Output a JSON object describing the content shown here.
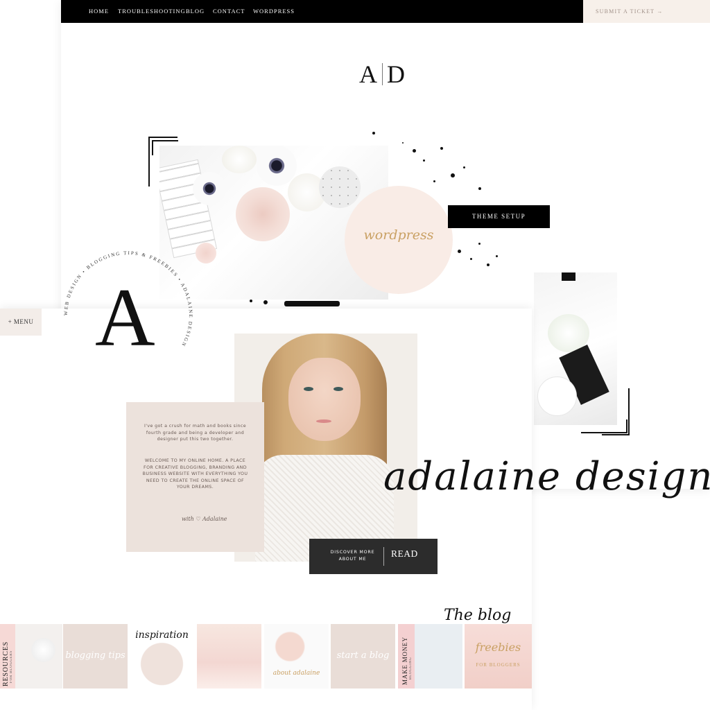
{
  "back_site": {
    "nav": {
      "items": [
        "HOME",
        "TROUBLESHOOTING",
        "BLOG",
        "CONTACT",
        "WORDPRESS"
      ],
      "ticket_label": "SUBMIT A TICKET →"
    },
    "logo": {
      "left": "A",
      "right": "D"
    },
    "hero": {
      "circle_label": "wordpress",
      "cta_label": "THEME SETUP"
    }
  },
  "front_site": {
    "menu_label": "+ MENU",
    "logo_letter": "A",
    "logo_ring_text": "WEB DESIGN • BLOGGING TIPS & FREEBIES • ADALAINE DESIGN",
    "intro": {
      "paragraph_1": "I've got a crush for math and books since fourth grade and being a developer and designer put this two together.",
      "paragraph_2": "WELCOME TO MY ONLINE HOME. A PLACE FOR CREATIVE BLOGGING, BRANDING AND BUSINESS WEBSITE WITH EVERYTHING YOU NEED TO CREATE THE ONLINE SPACE OF YOUR DREAMS.",
      "signoff": "with ♡ Adalaine"
    },
    "cta": {
      "small_label": "DISCOVER MORE ABOUT ME",
      "big_label": "READ"
    },
    "brand_script": "adalaine design",
    "blog_heading": "The blog",
    "thumbnails": [
      {
        "label": "RESOURCES",
        "sub": "FOR BLOGGERS"
      },
      {
        "label": "blogging tips",
        "sub": ""
      },
      {
        "label": "inspiration",
        "sub": ""
      },
      {
        "label": "",
        "sub": ""
      },
      {
        "label": "about adalaine",
        "sub": ""
      },
      {
        "label": "start a blog",
        "sub": ""
      },
      {
        "label": "MAKE MONEY",
        "sub": "BLOGGING"
      },
      {
        "label": "freebies",
        "sub": "FOR BLOGGERS"
      }
    ]
  },
  "colors": {
    "nav_bg": "#000000",
    "ticket_bg": "#f7f0ea",
    "blush": "#f9ece6",
    "card_bg": "#ece2dc",
    "gold": "#c9a063",
    "cta_bg": "#2c2c2c"
  }
}
